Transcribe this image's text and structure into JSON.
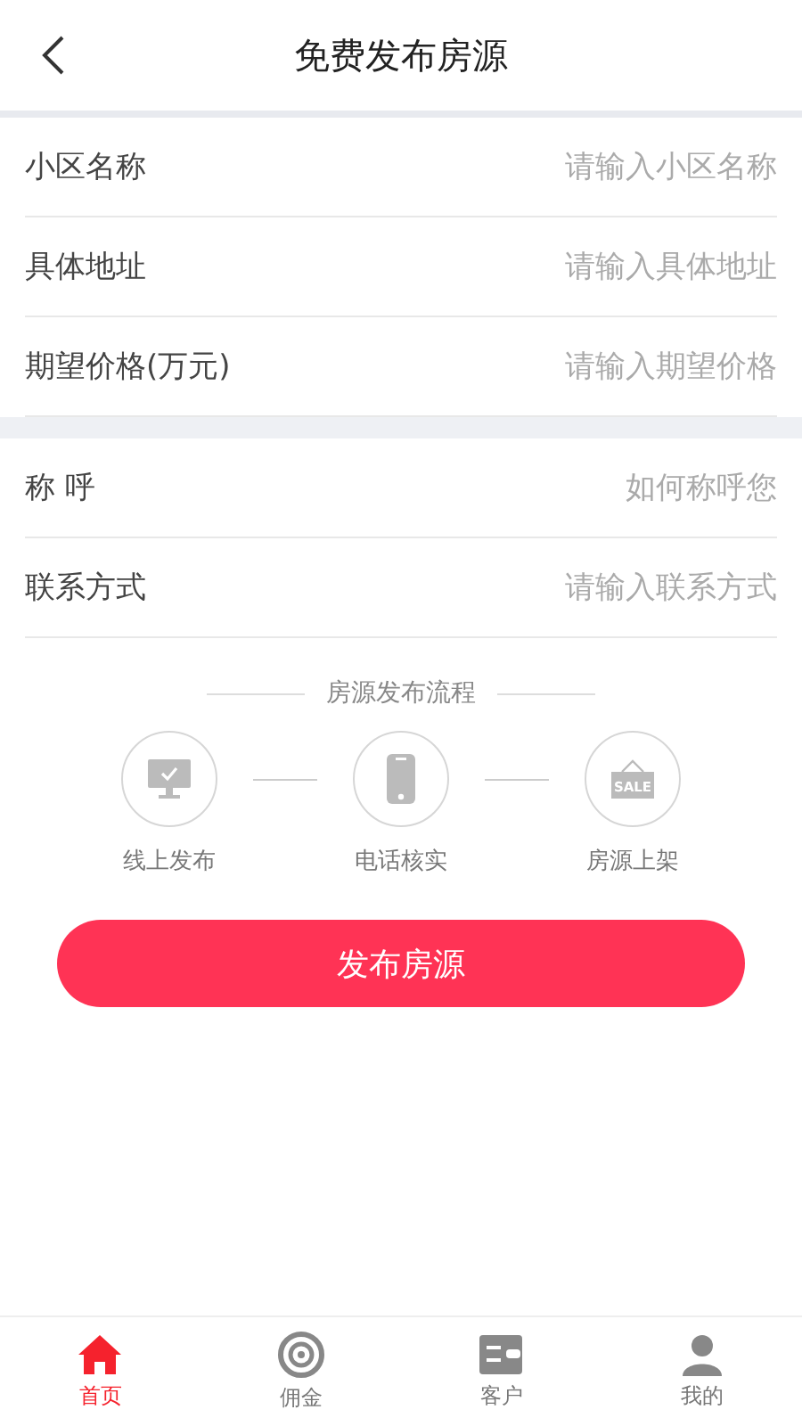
{
  "header": {
    "title": "免费发布房源"
  },
  "sections": [
    {
      "fields": [
        {
          "label": "小区名称",
          "placeholder": "请输入小区名称"
        },
        {
          "label": "具体地址",
          "placeholder": "请输入具体地址"
        },
        {
          "label": "期望价格(万元)",
          "placeholder": "请输入期望价格"
        }
      ]
    },
    {
      "fields": [
        {
          "label": "称 呼",
          "placeholder": "如何称呼您"
        },
        {
          "label": "联系方式",
          "placeholder": "请输入联系方式"
        }
      ]
    }
  ],
  "process": {
    "title": "房源发布流程",
    "steps": [
      {
        "kind": "monitor",
        "label": "线上发布"
      },
      {
        "kind": "phone",
        "label": "电话核实"
      },
      {
        "kind": "sign",
        "label": "房源上架",
        "sign_text": "SALE"
      }
    ]
  },
  "submit": "发布房源",
  "tabbar": [
    {
      "kind": "home",
      "label": "首页",
      "selected": true
    },
    {
      "kind": "coin",
      "label": "佣金",
      "selected": false
    },
    {
      "kind": "card",
      "label": "客户",
      "selected": false
    },
    {
      "kind": "person",
      "label": "我的",
      "selected": false
    }
  ]
}
